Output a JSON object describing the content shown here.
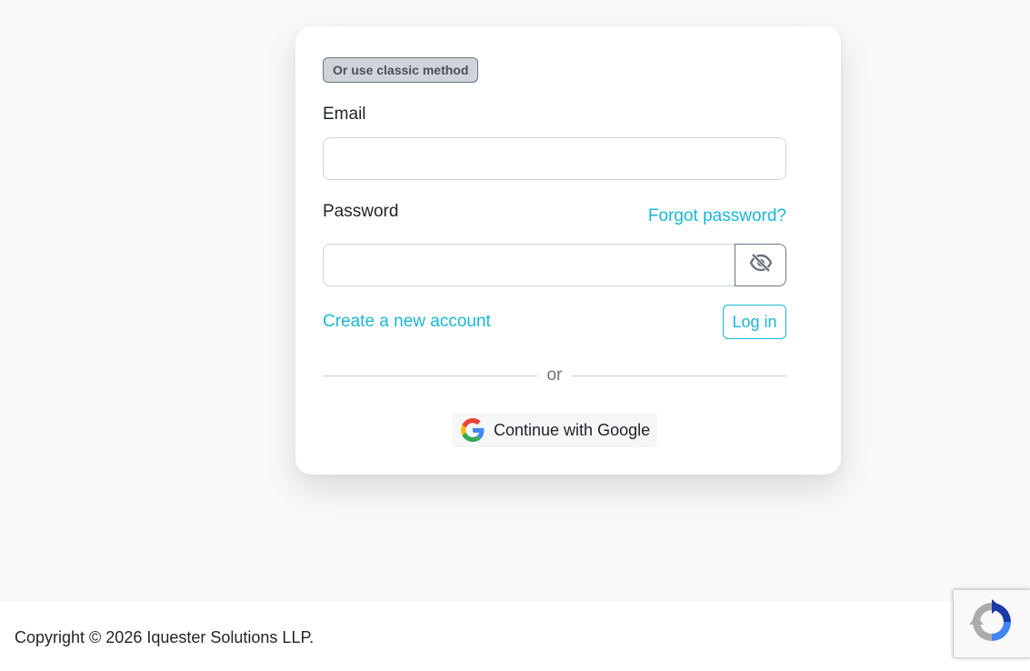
{
  "login_card": {
    "badge_text": "Or use classic method",
    "email_label": "Email",
    "email_value": "",
    "password_label": "Password",
    "password_value": "",
    "forgot_password_link": "Forgot password?",
    "toggle_password_icon": "eye-slash-icon",
    "create_account_link": "Create a new account",
    "login_button": "Log in",
    "divider_text": "or",
    "google_button": "Continue with Google",
    "google_icon": "google-g-icon"
  },
  "footer": {
    "copyright": "Copyright © 2026 Iquester Solutions LLP."
  },
  "recaptcha": {
    "icon": "recaptcha-icon"
  },
  "colors": {
    "accent": "#1ab6d6",
    "background": "#f8f9fa",
    "card": "#ffffff",
    "badge_bg": "#ced4da"
  }
}
